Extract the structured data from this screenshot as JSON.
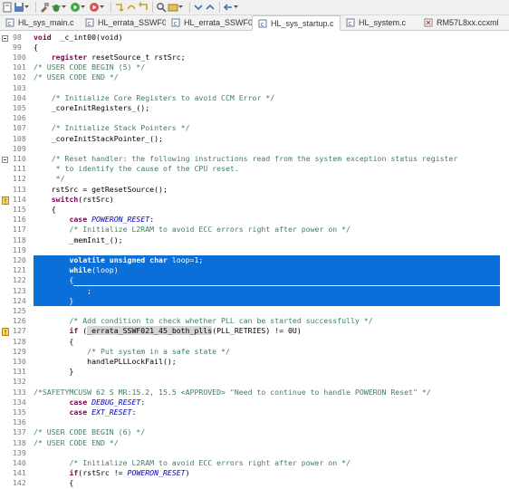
{
  "toolbar": {
    "buttons": [
      "new-file-icon",
      "save-icon",
      "build-icon",
      "debug-icon",
      "run-icon",
      "external-tools-icon",
      "step-into-icon",
      "step-over-icon",
      "step-return-icon",
      "search-icon",
      "open-type-icon",
      "next-annotation-icon",
      "prev-annotation-icon",
      "back-icon"
    ]
  },
  "tabs": [
    {
      "label": "HL_sys_main.c",
      "active": false,
      "closable": false
    },
    {
      "label": "HL_errata_SSWF0...",
      "active": false,
      "closable": false
    },
    {
      "label": "HL_errata_SSWF0...",
      "active": false,
      "closable": false
    },
    {
      "label": "HL_sys_startup.c",
      "active": true,
      "closable": true
    },
    {
      "label": "HL_system.c",
      "active": false,
      "closable": false
    },
    {
      "label": "RM57L8xx.ccxml",
      "active": false,
      "closable": false
    }
  ],
  "close_glyph": "✕",
  "colors": {
    "selection": "#0a6fd8",
    "keyword": "#7f0055",
    "comment": "#3f7f5f",
    "constant": "#0000c0"
  },
  "lines": [
    {
      "n": "98",
      "fold": "minus",
      "t": [
        [
          "kw",
          "void"
        ],
        [
          "",
          "  _c_int00(void)"
        ]
      ]
    },
    {
      "n": "99",
      "t": [
        [
          "",
          "{"
        ]
      ]
    },
    {
      "n": "100",
      "t": [
        [
          "",
          "    "
        ],
        [
          "kw",
          "register"
        ],
        [
          "",
          " resetSource_t rstSrc;"
        ]
      ]
    },
    {
      "n": "101",
      "t": [
        [
          "cm",
          "/* USER CODE BEGIN (5) */"
        ]
      ]
    },
    {
      "n": "102",
      "t": [
        [
          "cm",
          "/* USER CODE END */"
        ]
      ]
    },
    {
      "n": "103",
      "t": [
        [
          "",
          ""
        ]
      ]
    },
    {
      "n": "104",
      "t": [
        [
          "",
          "    "
        ],
        [
          "cm",
          "/* Initialize Core Registers to avoid CCM Error */"
        ]
      ]
    },
    {
      "n": "105",
      "t": [
        [
          "",
          "    _coreInitRegisters_();"
        ]
      ]
    },
    {
      "n": "106",
      "t": [
        [
          "",
          ""
        ]
      ]
    },
    {
      "n": "107",
      "t": [
        [
          "",
          "    "
        ],
        [
          "cm",
          "/* Initialize Stack Pointers */"
        ]
      ]
    },
    {
      "n": "108",
      "t": [
        [
          "",
          "    _coreInitStackPointer_();"
        ]
      ]
    },
    {
      "n": "109",
      "t": [
        [
          "",
          ""
        ]
      ]
    },
    {
      "n": "110",
      "fold": "minus",
      "t": [
        [
          "",
          "    "
        ],
        [
          "cm",
          "/* Reset handler: the following instructions read from the system exception status register"
        ]
      ]
    },
    {
      "n": "111",
      "t": [
        [
          "",
          "     "
        ],
        [
          "cm",
          "* to identify the cause of the CPU reset."
        ]
      ]
    },
    {
      "n": "112",
      "t": [
        [
          "",
          "     "
        ],
        [
          "cm",
          "*/"
        ]
      ]
    },
    {
      "n": "113",
      "t": [
        [
          "",
          "    rstSrc = getResetSource();"
        ]
      ]
    },
    {
      "n": "114",
      "mark": true,
      "t": [
        [
          "",
          "    "
        ],
        [
          "kw",
          "switch"
        ],
        [
          "",
          "(rstSrc)"
        ]
      ]
    },
    {
      "n": "115",
      "t": [
        [
          "",
          "    {"
        ]
      ]
    },
    {
      "n": "116",
      "t": [
        [
          "",
          "        "
        ],
        [
          "kw",
          "case"
        ],
        [
          "",
          " "
        ],
        [
          "it",
          "POWERON_RESET"
        ],
        [
          "",
          ":"
        ]
      ]
    },
    {
      "n": "117",
      "t": [
        [
          "",
          "        "
        ],
        [
          "cm",
          "/* Initialize L2RAM to avoid ECC errors right after power on */"
        ]
      ]
    },
    {
      "n": "118",
      "t": [
        [
          "",
          "        _memInit_();"
        ]
      ]
    },
    {
      "n": "119",
      "t": [
        [
          "",
          ""
        ]
      ]
    },
    {
      "n": "120",
      "sel": true,
      "t": [
        [
          "",
          "        "
        ],
        [
          "kw",
          "volatile unsigned char"
        ],
        [
          "",
          " loop=1;"
        ]
      ]
    },
    {
      "n": "121",
      "sel": true,
      "t": [
        [
          "",
          "        "
        ],
        [
          "kw",
          "while"
        ],
        [
          "",
          "(loop)"
        ]
      ]
    },
    {
      "n": "122",
      "sel": true,
      "t": [
        [
          "",
          "        {"
        ]
      ]
    },
    {
      "n": "123",
      "sel": true,
      "t": [
        [
          "",
          "            ;"
        ]
      ]
    },
    {
      "n": "124",
      "sel": true,
      "t": [
        [
          "",
          "        }"
        ]
      ]
    },
    {
      "n": "125",
      "t": [
        [
          "",
          ""
        ]
      ]
    },
    {
      "n": "126",
      "t": [
        [
          "",
          "        "
        ],
        [
          "cm",
          "/* Add condition to check whether PLL can be started successfully */"
        ]
      ]
    },
    {
      "n": "127",
      "mark": true,
      "t": [
        [
          "",
          "        "
        ],
        [
          "kw",
          "if"
        ],
        [
          "",
          " ("
        ],
        [
          "hl",
          "_errata_SSWF021_45_both_plls"
        ],
        [
          "",
          "(PLL_RETRIES) != 0U)"
        ]
      ]
    },
    {
      "n": "128",
      "t": [
        [
          "",
          "        {"
        ]
      ]
    },
    {
      "n": "129",
      "t": [
        [
          "",
          "            "
        ],
        [
          "cm",
          "/* Put system in a safe state */"
        ]
      ]
    },
    {
      "n": "130",
      "t": [
        [
          "",
          "            handlePLLLockFail();"
        ]
      ]
    },
    {
      "n": "131",
      "t": [
        [
          "",
          "        }"
        ]
      ]
    },
    {
      "n": "132",
      "t": [
        [
          "",
          ""
        ]
      ]
    },
    {
      "n": "133",
      "t": [
        [
          "cm",
          "/*SAFETYMCUSW 62 S MR:15.2, 15.5 <APPROVED> \"Need to continue to handle POWERON Reset\" */"
        ]
      ]
    },
    {
      "n": "134",
      "t": [
        [
          "",
          "        "
        ],
        [
          "kw",
          "case"
        ],
        [
          "",
          " "
        ],
        [
          "it",
          "DEBUG_RESET"
        ],
        [
          "",
          ":"
        ]
      ]
    },
    {
      "n": "135",
      "t": [
        [
          "",
          "        "
        ],
        [
          "kw",
          "case"
        ],
        [
          "",
          " "
        ],
        [
          "it",
          "EXT_RESET"
        ],
        [
          "",
          ":"
        ]
      ]
    },
    {
      "n": "136",
      "t": [
        [
          "",
          ""
        ]
      ]
    },
    {
      "n": "137",
      "t": [
        [
          "cm",
          "/* USER CODE BEGIN (6) */"
        ]
      ]
    },
    {
      "n": "138",
      "t": [
        [
          "cm",
          "/* USER CODE END */"
        ]
      ]
    },
    {
      "n": "139",
      "t": [
        [
          "",
          ""
        ]
      ]
    },
    {
      "n": "140",
      "t": [
        [
          "",
          "        "
        ],
        [
          "cm",
          "/* Initialize L2RAM to avoid ECC errors right after power on */"
        ]
      ]
    },
    {
      "n": "141",
      "t": [
        [
          "",
          "        "
        ],
        [
          "kw",
          "if"
        ],
        [
          "",
          "(rstSrc != "
        ],
        [
          "it",
          "POWERON_RESET"
        ],
        [
          "",
          ")"
        ]
      ]
    },
    {
      "n": "142",
      "t": [
        [
          "",
          "        {"
        ]
      ]
    }
  ]
}
